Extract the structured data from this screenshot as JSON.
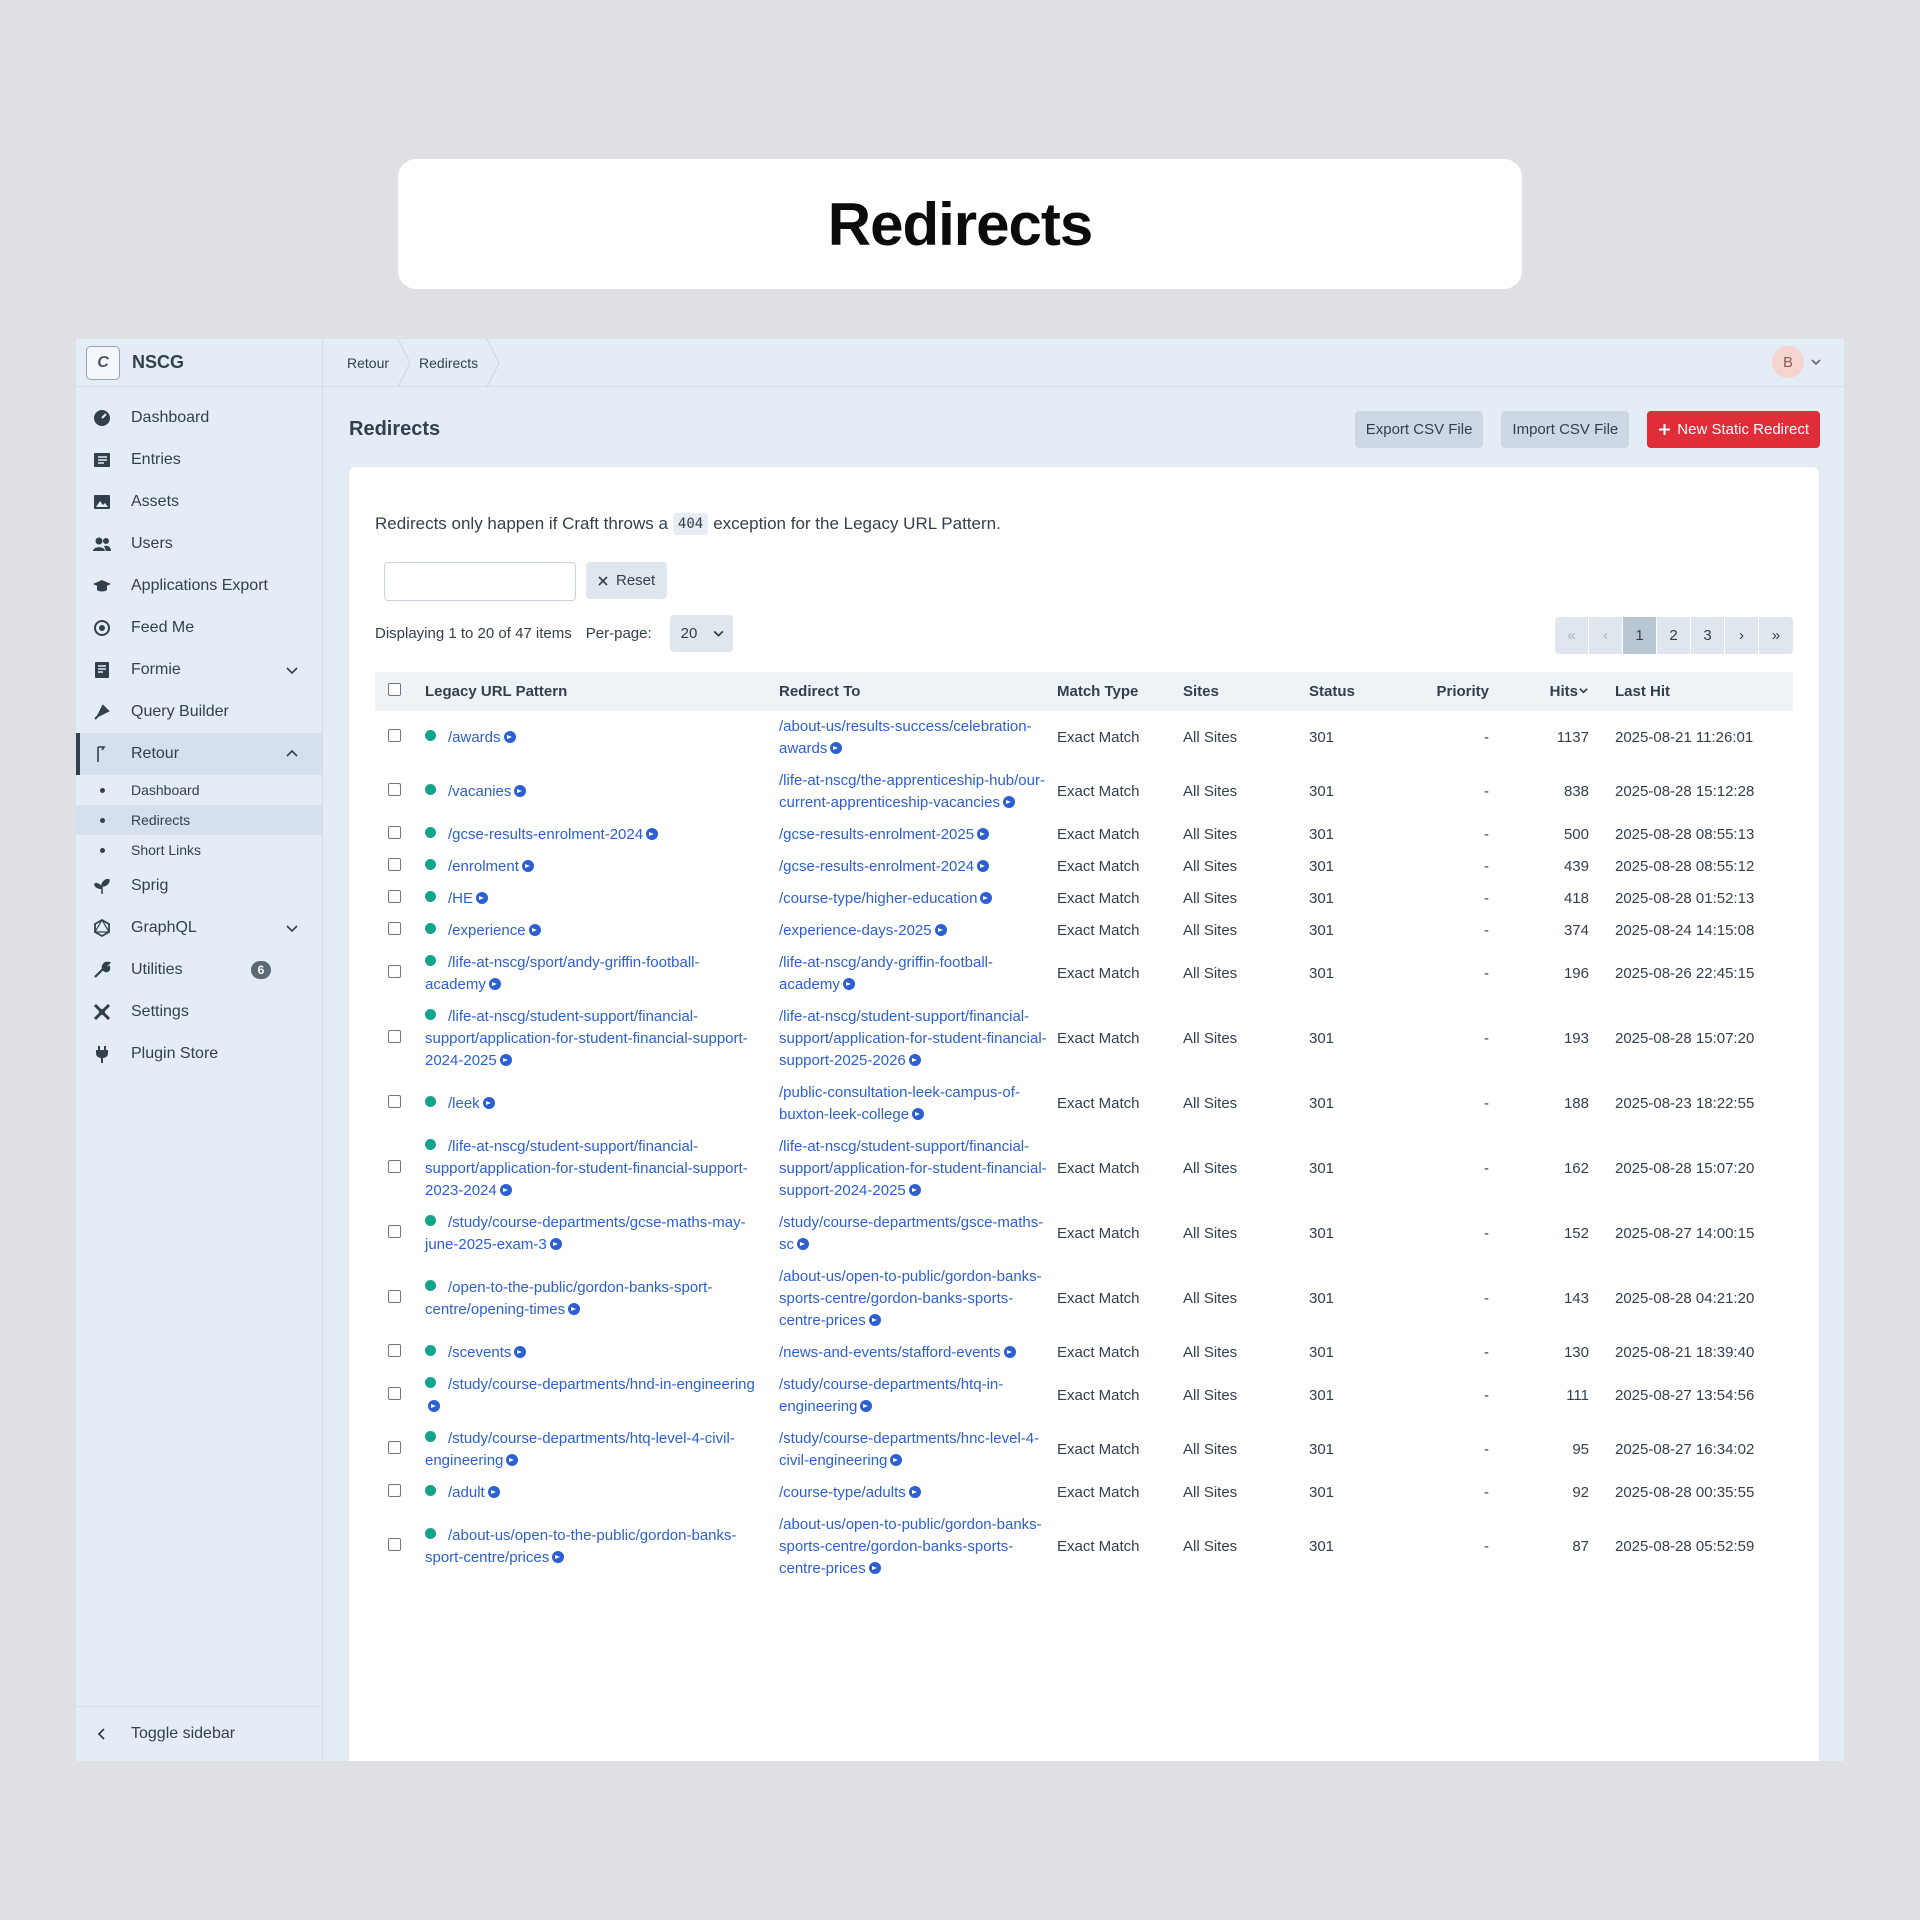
{
  "card_title": "Redirects",
  "site": {
    "logo_letter": "C",
    "name": "NSCG"
  },
  "nav": {
    "items": [
      {
        "label": "Dashboard"
      },
      {
        "label": "Entries"
      },
      {
        "label": "Assets"
      },
      {
        "label": "Users"
      },
      {
        "label": "Applications Export"
      },
      {
        "label": "Feed Me"
      },
      {
        "label": "Formie"
      },
      {
        "label": "Query Builder"
      },
      {
        "label": "Retour"
      },
      {
        "label": "Sprig"
      },
      {
        "label": "GraphQL"
      },
      {
        "label": "Utilities",
        "badge": "6"
      },
      {
        "label": "Settings"
      },
      {
        "label": "Plugin Store"
      }
    ],
    "retour_sub": [
      {
        "label": "Dashboard"
      },
      {
        "label": "Redirects"
      },
      {
        "label": "Short Links"
      }
    ],
    "toggle_sidebar": "Toggle sidebar"
  },
  "breadcrumb": [
    "Retour",
    "Redirects"
  ],
  "user": {
    "initial": "B"
  },
  "page": {
    "title": "Redirects",
    "export_csv": "Export CSV File",
    "import_csv": "Import CSV File",
    "new_redirect": "New Static Redirect"
  },
  "notice": {
    "before": "Redirects only happen if Craft throws a",
    "code": "404",
    "after": "exception for the Legacy URL Pattern."
  },
  "search": {
    "placeholder": "",
    "reset_label": "Reset"
  },
  "display": {
    "text": "Displaying 1 to 20 of 47 items",
    "perpage_label": "Per-page:",
    "perpage_value": "20"
  },
  "pager": {
    "first": "«",
    "prev": "‹",
    "pages": [
      "1",
      "2",
      "3"
    ],
    "current": "1",
    "next": "›",
    "last": "»"
  },
  "table": {
    "headers": {
      "legacy": "Legacy URL Pattern",
      "redirect": "Redirect To",
      "match": "Match Type",
      "sites": "Sites",
      "status": "Status",
      "priority": "Priority",
      "hits": "Hits",
      "last_hit": "Last Hit"
    },
    "rows": [
      {
        "legacy": "/awards",
        "redirect": "/about-us/results-success/celebration-awards",
        "match": "Exact Match",
        "sites": "All Sites",
        "status": "301",
        "priority": "-",
        "hits": "1137",
        "last_hit": "2025-08-21 11:26:01"
      },
      {
        "legacy": "/vacanies",
        "redirect": "/life-at-nscg/the-apprenticeship-hub/our-current-apprenticeship-vacancies",
        "match": "Exact Match",
        "sites": "All Sites",
        "status": "301",
        "priority": "-",
        "hits": "838",
        "last_hit": "2025-08-28 15:12:28"
      },
      {
        "legacy": "/gcse-results-enrolment-2024",
        "redirect": "/gcse-results-enrolment-2025",
        "match": "Exact Match",
        "sites": "All Sites",
        "status": "301",
        "priority": "-",
        "hits": "500",
        "last_hit": "2025-08-28 08:55:13"
      },
      {
        "legacy": "/enrolment",
        "redirect": "/gcse-results-enrolment-2024",
        "match": "Exact Match",
        "sites": "All Sites",
        "status": "301",
        "priority": "-",
        "hits": "439",
        "last_hit": "2025-08-28 08:55:12"
      },
      {
        "legacy": "/HE",
        "redirect": "/course-type/higher-education",
        "match": "Exact Match",
        "sites": "All Sites",
        "status": "301",
        "priority": "-",
        "hits": "418",
        "last_hit": "2025-08-28 01:52:13"
      },
      {
        "legacy": "/experience",
        "redirect": "/experience-days-2025",
        "match": "Exact Match",
        "sites": "All Sites",
        "status": "301",
        "priority": "-",
        "hits": "374",
        "last_hit": "2025-08-24 14:15:08"
      },
      {
        "legacy": "/life-at-nscg/sport/andy-griffin-football-academy",
        "redirect": "/life-at-nscg/andy-griffin-football-academy",
        "match": "Exact Match",
        "sites": "All Sites",
        "status": "301",
        "priority": "-",
        "hits": "196",
        "last_hit": "2025-08-26 22:45:15"
      },
      {
        "legacy": "/life-at-nscg/student-support/financial-support/application-for-student-financial-support-2024-2025",
        "redirect": "/life-at-nscg/student-support/financial-support/application-for-student-financial-support-2025-2026",
        "match": "Exact Match",
        "sites": "All Sites",
        "status": "301",
        "priority": "-",
        "hits": "193",
        "last_hit": "2025-08-28 15:07:20"
      },
      {
        "legacy": "/leek",
        "redirect": "/public-consultation-leek-campus-of-buxton-leek-college",
        "match": "Exact Match",
        "sites": "All Sites",
        "status": "301",
        "priority": "-",
        "hits": "188",
        "last_hit": "2025-08-23 18:22:55"
      },
      {
        "legacy": "/life-at-nscg/student-support/financial-support/application-for-student-financial-support-2023-2024",
        "redirect": "/life-at-nscg/student-support/financial-support/application-for-student-financial-support-2024-2025",
        "match": "Exact Match",
        "sites": "All Sites",
        "status": "301",
        "priority": "-",
        "hits": "162",
        "last_hit": "2025-08-28 15:07:20"
      },
      {
        "legacy": "/study/course-departments/gcse-maths-may-june-2025-exam-3",
        "redirect": "/study/course-departments/gsce-maths-sc",
        "match": "Exact Match",
        "sites": "All Sites",
        "status": "301",
        "priority": "-",
        "hits": "152",
        "last_hit": "2025-08-27 14:00:15"
      },
      {
        "legacy": "/open-to-the-public/gordon-banks-sport-centre/opening-times",
        "redirect": "/about-us/open-to-public/gordon-banks-sports-centre/gordon-banks-sports-centre-prices",
        "match": "Exact Match",
        "sites": "All Sites",
        "status": "301",
        "priority": "-",
        "hits": "143",
        "last_hit": "2025-08-28 04:21:20"
      },
      {
        "legacy": "/scevents",
        "redirect": "/news-and-events/stafford-events",
        "match": "Exact Match",
        "sites": "All Sites",
        "status": "301",
        "priority": "-",
        "hits": "130",
        "last_hit": "2025-08-21 18:39:40"
      },
      {
        "legacy": "/study/course-departments/hnd-in-engineering",
        "redirect": "/study/course-departments/htq-in-engineering",
        "match": "Exact Match",
        "sites": "All Sites",
        "status": "301",
        "priority": "-",
        "hits": "111",
        "last_hit": "2025-08-27 13:54:56"
      },
      {
        "legacy": "/study/course-departments/htq-level-4-civil-engineering",
        "redirect": "/study/course-departments/hnc-level-4-civil-engineering",
        "match": "Exact Match",
        "sites": "All Sites",
        "status": "301",
        "priority": "-",
        "hits": "95",
        "last_hit": "2025-08-27 16:34:02"
      },
      {
        "legacy": "/adult",
        "redirect": "/course-type/adults",
        "match": "Exact Match",
        "sites": "All Sites",
        "status": "301",
        "priority": "-",
        "hits": "92",
        "last_hit": "2025-08-28 00:35:55"
      },
      {
        "legacy": "/about-us/open-to-the-public/gordon-banks-sport-centre/prices",
        "redirect": "/about-us/open-to-public/gordon-banks-sports-centre/gordon-banks-sports-centre-prices",
        "match": "Exact Match",
        "sites": "All Sites",
        "status": "301",
        "priority": "-",
        "hits": "87",
        "last_hit": "2025-08-28 05:52:59"
      }
    ]
  },
  "colors": {
    "accent_red": "#e12d39",
    "link_blue": "#2c5fd1",
    "status_green": "#12a58b"
  }
}
